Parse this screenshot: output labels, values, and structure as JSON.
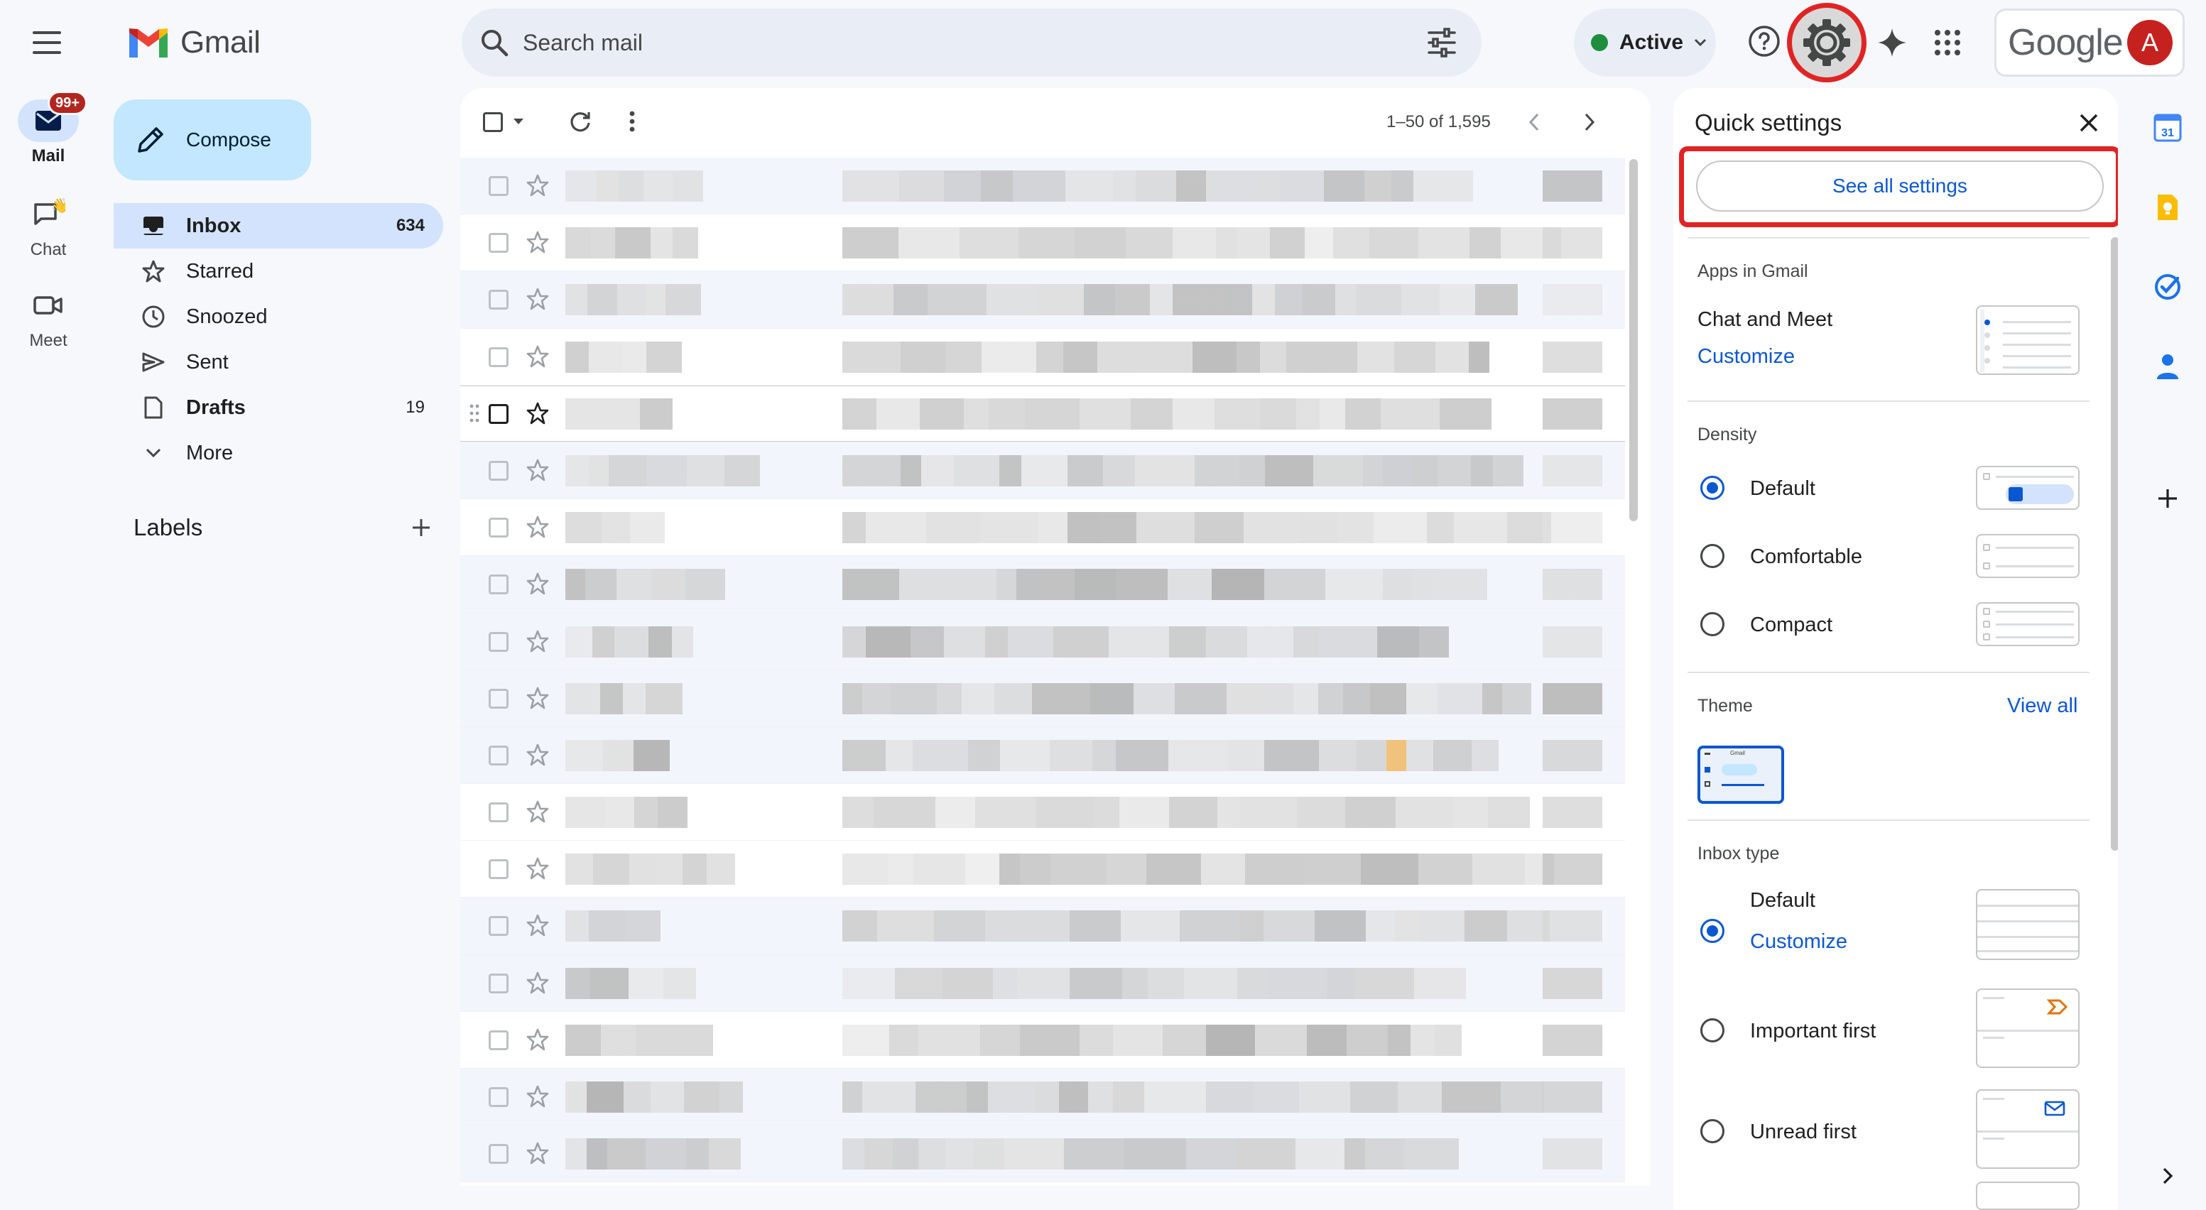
{
  "app": {
    "name": "Gmail"
  },
  "rail": {
    "items": [
      {
        "label": "Mail",
        "badge": "99+"
      },
      {
        "label": "Chat"
      },
      {
        "label": "Meet"
      }
    ]
  },
  "search": {
    "placeholder": "Search mail"
  },
  "status": {
    "label": "Active",
    "color": "#1e8e3e"
  },
  "account": {
    "brand": "Google",
    "initial": "A"
  },
  "compose": {
    "label": "Compose"
  },
  "nav": {
    "items": [
      {
        "label": "Inbox",
        "count": "634"
      },
      {
        "label": "Starred",
        "count": ""
      },
      {
        "label": "Snoozed",
        "count": ""
      },
      {
        "label": "Sent",
        "count": ""
      },
      {
        "label": "Drafts",
        "count": "19"
      },
      {
        "label": "More",
        "count": ""
      }
    ],
    "labels_title": "Labels"
  },
  "list": {
    "range": "1–50 of 1,595"
  },
  "quick_settings": {
    "title": "Quick settings",
    "see_all": "See all settings",
    "apps_section": "Apps in Gmail",
    "chat_meet": "Chat and Meet",
    "customize": "Customize",
    "density_section": "Density",
    "density_options": [
      "Default",
      "Comfortable",
      "Compact"
    ],
    "density_selected": "Default",
    "theme_section": "Theme",
    "view_all": "View all",
    "theme_thumb_text": "Gmail",
    "inbox_type_section": "Inbox type",
    "inbox_options": [
      "Default",
      "Important first",
      "Unread first"
    ],
    "inbox_selected": "Default",
    "inbox_customize": "Customize"
  },
  "side_panel": {
    "calendar_day": "31"
  },
  "colors": {
    "accent": "#0b57d0",
    "highlight": "#e02424",
    "compose_bg": "#c2e7ff",
    "nav_active": "#d3e3fd"
  }
}
